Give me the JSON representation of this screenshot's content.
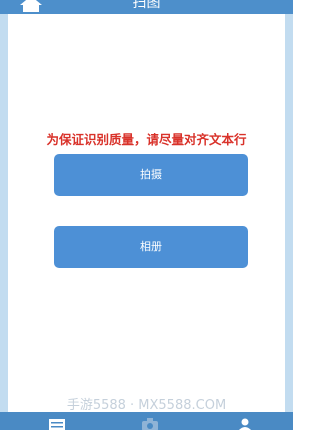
{
  "header": {
    "title": "扫图",
    "home_icon": "home-icon"
  },
  "main": {
    "hint": "为保证识别质量，请尽量对齐文本行",
    "shoot_label": "拍摄",
    "album_label": "相册"
  },
  "watermark": "手游5588 · MX5588.COM",
  "bottom_nav": {
    "icons": [
      "list-icon",
      "camera-icon",
      "user-icon"
    ]
  },
  "colors": {
    "bar": "#4d8fcb",
    "button": "#4d90d6",
    "hint": "#d9322a",
    "side": "#c2dcf0"
  }
}
